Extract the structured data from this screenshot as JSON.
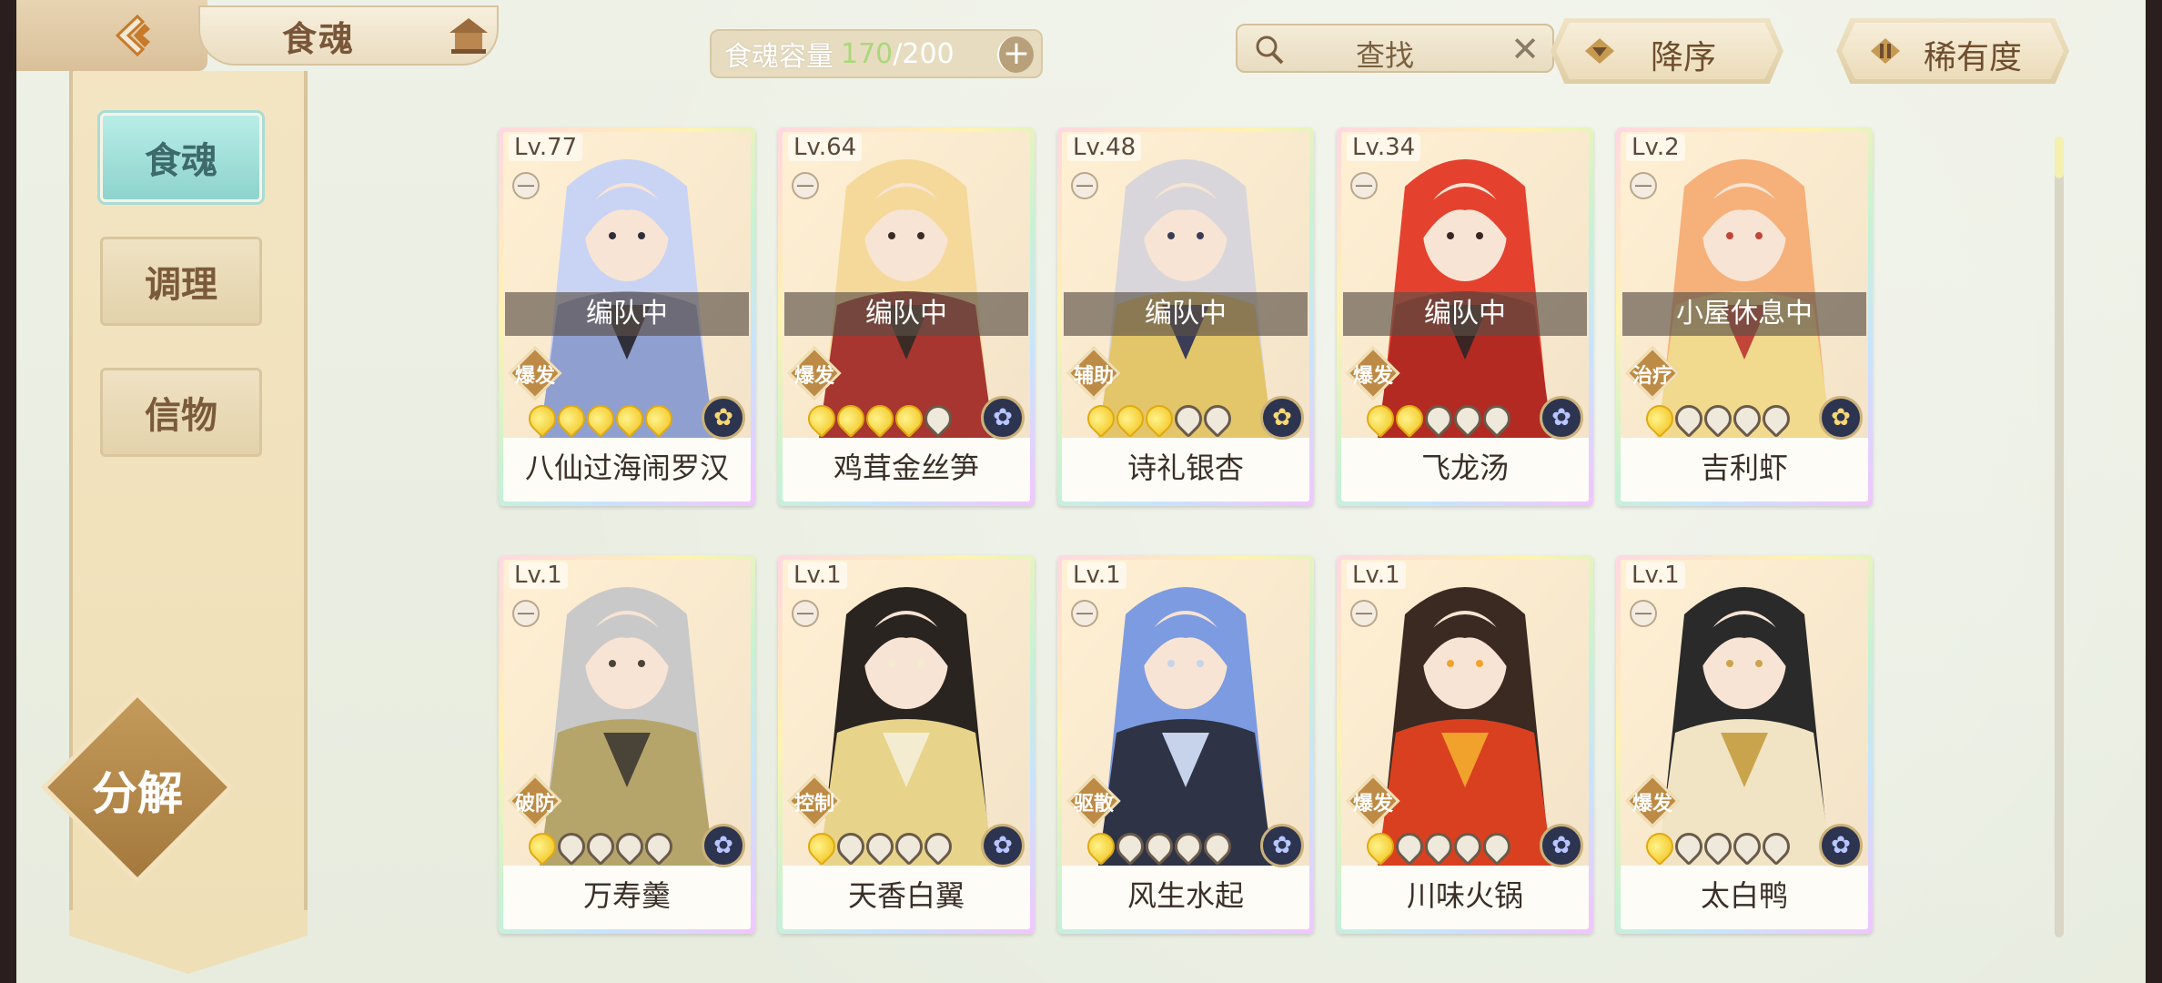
{
  "header": {
    "title": "食魂",
    "capacity_label": "食魂容量",
    "capacity_current": "170",
    "capacity_max": "/200",
    "add_label": "+",
    "search_placeholder": "查找",
    "clear_label": "✕",
    "sort_label": "降序",
    "rarity_label": "稀有度"
  },
  "sidebar": {
    "items": [
      {
        "label": "食魂"
      },
      {
        "label": "调理"
      },
      {
        "label": "信物"
      }
    ],
    "decompose_label": "分解"
  },
  "cards": [
    {
      "level": "Lv.77",
      "status": "编队中",
      "role": "爆发",
      "stars": 5,
      "name": "八仙过海闹罗汉",
      "element": "gold",
      "palette": [
        "#c9d3f4",
        "#8f9fd0",
        "#2f2f3a"
      ]
    },
    {
      "level": "Lv.64",
      "status": "编队中",
      "role": "爆发",
      "stars": 4,
      "name": "鸡茸金丝笋",
      "element": "blue",
      "palette": [
        "#f5d99a",
        "#a6362f",
        "#3b2b25"
      ]
    },
    {
      "level": "Lv.48",
      "status": "编队中",
      "role": "辅助",
      "stars": 3,
      "name": "诗礼银杏",
      "element": "gold",
      "palette": [
        "#d9d6db",
        "#e3c56a",
        "#3a3d55"
      ]
    },
    {
      "level": "Lv.34",
      "status": "编队中",
      "role": "爆发",
      "stars": 2,
      "name": "飞龙汤",
      "element": "blue",
      "palette": [
        "#e4422e",
        "#b22a22",
        "#3a2424"
      ]
    },
    {
      "level": "Lv.2",
      "status": "小屋休息中",
      "role": "治疗",
      "stars": 1,
      "name": "吉利虾",
      "element": "gold",
      "palette": [
        "#f6b079",
        "#f1d98d",
        "#c2453a"
      ]
    },
    {
      "level": "Lv.1",
      "status": "",
      "role": "破防",
      "stars": 1,
      "name": "万寿羹",
      "element": "blue",
      "palette": [
        "#c9c9c9",
        "#b6a56b",
        "#4a4438"
      ]
    },
    {
      "level": "Lv.1",
      "status": "",
      "role": "控制",
      "stars": 1,
      "name": "天香白翼",
      "element": "blue",
      "palette": [
        "#2a2420",
        "#e7d48a",
        "#f4ecd0"
      ]
    },
    {
      "level": "Lv.1",
      "status": "",
      "role": "驱散",
      "stars": 1,
      "name": "风生水起",
      "element": "blue",
      "palette": [
        "#7d9be0",
        "#2e3346",
        "#c6d3ea"
      ]
    },
    {
      "level": "Lv.1",
      "status": "",
      "role": "爆发",
      "stars": 1,
      "name": "川味火锅",
      "element": "blue",
      "palette": [
        "#3a2a22",
        "#d9401f",
        "#f1a22c"
      ]
    },
    {
      "level": "Lv.1",
      "status": "",
      "role": "爆发",
      "stars": 1,
      "name": "太白鸭",
      "element": "blue",
      "palette": [
        "#2a2a2a",
        "#f0e4c4",
        "#c9a44d"
      ]
    }
  ],
  "colors": {
    "accent_teal": "#8ed3cd",
    "gold": "#bd8b45",
    "background": "#e9eee1"
  }
}
